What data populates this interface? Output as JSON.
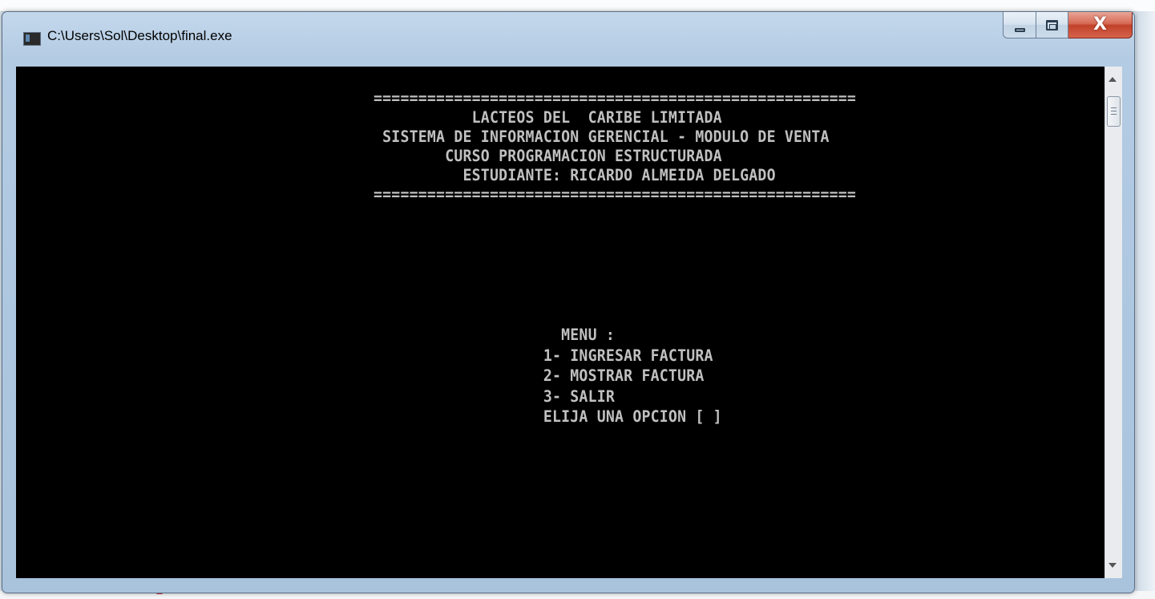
{
  "window": {
    "title": "C:\\Users\\Sol\\Desktop\\final.exe",
    "buttons": {
      "minimize": "minimize",
      "maximize": "maximize",
      "close": "X"
    }
  },
  "console": {
    "lines": [
      "                                        ======================================================",
      "                                                   LACTEOS DEL  CARIBE LIMITADA",
      "                                         SISTEMA DE INFORMACION GERENCIAL - MODULO DE VENTA",
      "                                                CURSO PROGRAMACION ESTRUCTURADA",
      "                                                  ESTUDIANTE: RICARDO ALMEIDA DELGADO",
      "                                        ======================================================",
      "",
      "",
      "",
      "",
      "",
      "                                                             MENU :",
      "                                                           1- INGRESAR FACTURA",
      "                                                           2- MOSTRAR FACTURA",
      "                                                           3- SALIR",
      "                                                           ELIJA UNA OPCION [ ]"
    ]
  },
  "colors": {
    "console_background": "#000000",
    "console_text": "#c0c0c0",
    "close_button": "#c2412a",
    "window_frame": "#b3cbe3"
  },
  "icons": {
    "app": "console-app-icon",
    "scroll_up": "arrow-up-icon",
    "scroll_down": "arrow-down-icon"
  }
}
